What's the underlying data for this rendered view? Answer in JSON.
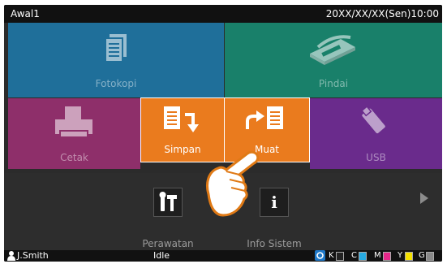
{
  "header": {
    "title": "Awal1",
    "datetime": "20XX/XX/XX(Sen)10:00"
  },
  "tiles": {
    "copy": {
      "label": "Fotokopi",
      "color": "#1f6f9a"
    },
    "scan": {
      "label": "Pindai",
      "color": "#19806a"
    },
    "print": {
      "label": "Cetak",
      "color": "#8e2f6a"
    },
    "store": {
      "label": "Simpan",
      "color": "#ea7b1e"
    },
    "load": {
      "label": "Muat",
      "color": "#ea7b1e"
    },
    "usb": {
      "label": "USB",
      "color": "#6a2b8c"
    }
  },
  "tools": {
    "maintenance": "Perawatan",
    "sysinfo": "Info Sistem",
    "info_glyph": "i"
  },
  "status": {
    "user": "J.Smith",
    "state": "Idle",
    "inks": [
      {
        "name": "K",
        "color": "#222222"
      },
      {
        "name": "C",
        "color": "#27a9e0"
      },
      {
        "name": "M",
        "color": "#e6288a"
      },
      {
        "name": "Y",
        "color": "#f4e000"
      },
      {
        "name": "G",
        "color": "#888888"
      }
    ]
  },
  "icons": [
    "copy-icon",
    "scanner-icon",
    "printer-icon",
    "store-icon",
    "load-icon",
    "usb-icon",
    "tools-icon",
    "info-icon",
    "user-icon",
    "pointer-hand-icon",
    "next-arrow-icon",
    "ink-drop-icon"
  ]
}
